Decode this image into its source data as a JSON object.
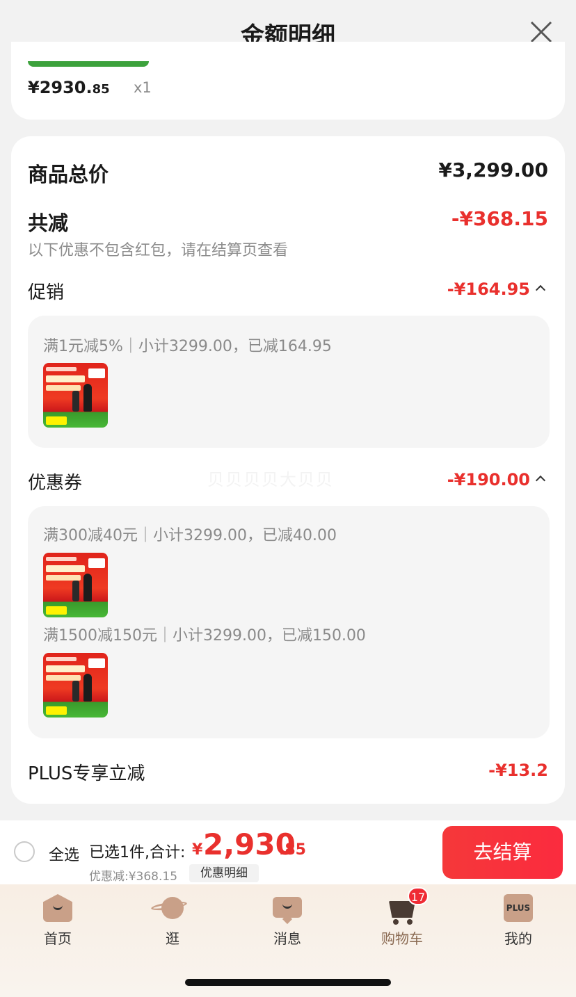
{
  "header": {
    "title": "金额明细"
  },
  "item": {
    "price_int": "¥2930.",
    "price_dec": "85",
    "qty": "x1"
  },
  "summary": {
    "total_label": "商品总价",
    "total_value": "¥3,299.00",
    "reduce_label": "共减",
    "reduce_value": "-¥368.15",
    "note": "以下优惠不包含红包，请在结算页查看"
  },
  "promo": {
    "label": "促销",
    "value": "-¥164.95",
    "rule": "满1元减5%｜小计3299.00，已减164.95"
  },
  "coupon": {
    "label": "优惠券",
    "value": "-¥190.00",
    "rules": [
      "满300减40元｜小计3299.00，已减40.00",
      "满1500减150元｜小计3299.00，已减150.00"
    ]
  },
  "watermark": "贝贝贝贝大贝贝",
  "plus": {
    "label": "PLUS专享立减",
    "value": "-¥13.2"
  },
  "checkout": {
    "select_all": "全选",
    "selected": "已选1件,合计:",
    "currency": "¥",
    "total_int": "2,930",
    "total_dec": ".85",
    "discount": "优惠减:¥368.15",
    "detail_button": "优惠明细",
    "go_button": "去结算"
  },
  "tabs": [
    {
      "label": "首页",
      "icon": "home-icon"
    },
    {
      "label": "逛",
      "icon": "planet-icon"
    },
    {
      "label": "消息",
      "icon": "message-icon"
    },
    {
      "label": "购物车",
      "icon": "cart-icon"
    },
    {
      "label": "我的",
      "icon": "plus-icon"
    }
  ],
  "cart_badge": "17",
  "plus_text": "PLUS",
  "colors": {
    "accent": "#e9302d",
    "button": "#f5383a",
    "green": "#3ca23c"
  }
}
